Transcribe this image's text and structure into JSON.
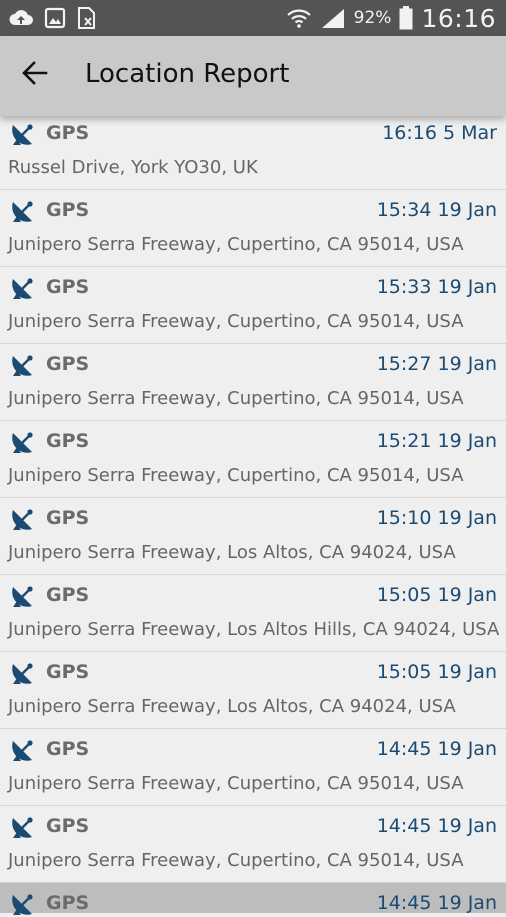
{
  "status_bar": {
    "battery_percent": "92%",
    "time": "16:16",
    "icons": [
      "cloud-upload-icon",
      "image-icon",
      "sim-card-off-icon",
      "wifi-icon",
      "signal-icon",
      "battery-icon"
    ]
  },
  "app_bar": {
    "title": "Location Report",
    "back_icon": "arrow-left-icon"
  },
  "colors": {
    "status_bar": "#545454",
    "app_bar": "#c9c9c9",
    "time_text": "#1b4a73",
    "icon": "#1b4a73"
  },
  "reports": [
    {
      "source": "GPS",
      "time": "16:16 5 Mar",
      "address": "Russel Drive, York YO30, UK"
    },
    {
      "source": "GPS",
      "time": "15:34 19 Jan",
      "address": "Junipero Serra Freeway, Cupertino, CA 95014, USA"
    },
    {
      "source": "GPS",
      "time": "15:33 19 Jan",
      "address": "Junipero Serra Freeway, Cupertino, CA 95014, USA"
    },
    {
      "source": "GPS",
      "time": "15:27 19 Jan",
      "address": "Junipero Serra Freeway, Cupertino, CA 95014, USA"
    },
    {
      "source": "GPS",
      "time": "15:21 19 Jan",
      "address": "Junipero Serra Freeway, Cupertino, CA 95014, USA"
    },
    {
      "source": "GPS",
      "time": "15:10 19 Jan",
      "address": "Junipero Serra Freeway, Los Altos, CA 94024, USA"
    },
    {
      "source": "GPS",
      "time": "15:05 19 Jan",
      "address": "Junipero Serra Freeway, Los Altos Hills, CA 94024, USA"
    },
    {
      "source": "GPS",
      "time": "15:05 19 Jan",
      "address": "Junipero Serra Freeway, Los Altos, CA 94024, USA"
    },
    {
      "source": "GPS",
      "time": "14:45 19 Jan",
      "address": "Junipero Serra Freeway, Cupertino, CA 95014, USA"
    },
    {
      "source": "GPS",
      "time": "14:45 19 Jan",
      "address": "Junipero Serra Freeway, Cupertino, CA 95014, USA"
    },
    {
      "source": "GPS",
      "time": "14:45 19 Jan",
      "address": ""
    }
  ]
}
